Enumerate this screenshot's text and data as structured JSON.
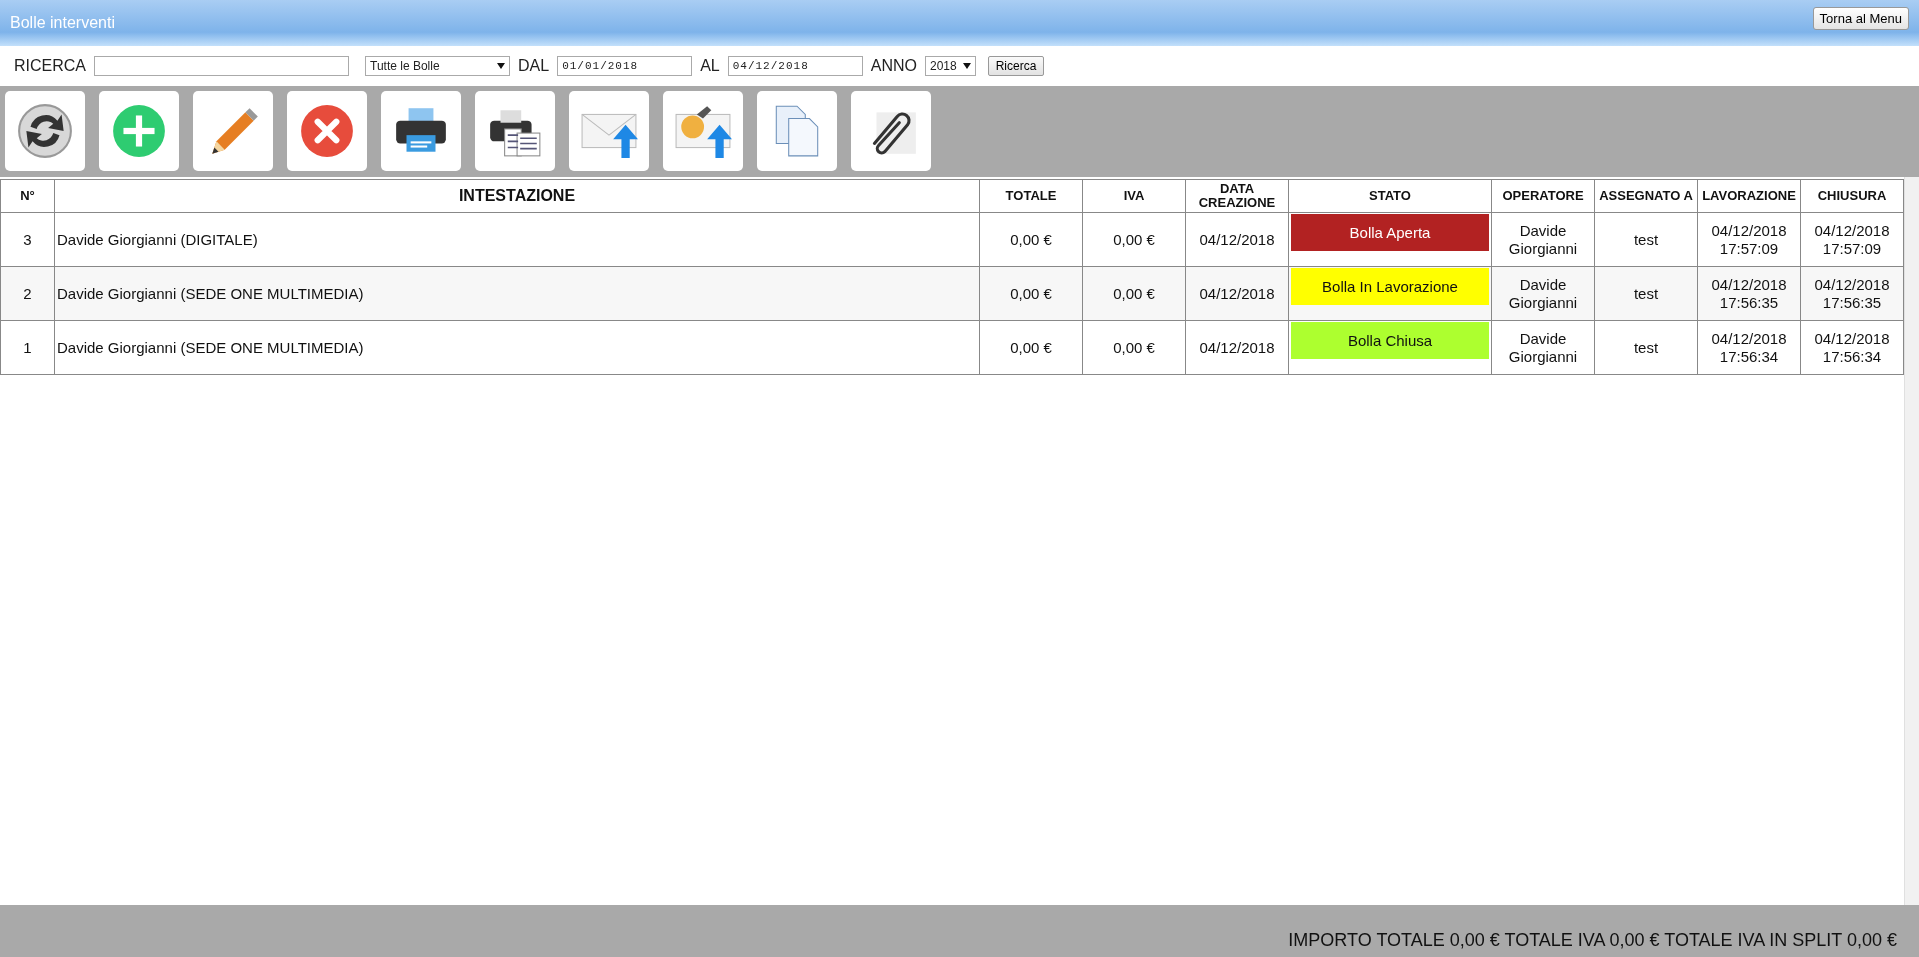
{
  "window": {
    "title": "Bolle interventi",
    "menu_button": "Torna al Menu"
  },
  "search_bar": {
    "search_label": "RICERCA",
    "filter": "Tutte le Bolle",
    "from_label": "DAL",
    "from_value": "01/01/2018",
    "to_label": "AL",
    "to_value": "04/12/2018",
    "year_label": "ANNO",
    "year": "2018",
    "button": "Ricerca"
  },
  "toolbar": [
    {
      "kind": "refresh"
    },
    {
      "kind": "add"
    },
    {
      "kind": "edit"
    },
    {
      "kind": "delete"
    },
    {
      "kind": "print"
    },
    {
      "kind": "print-list"
    },
    {
      "kind": "send-mail"
    },
    {
      "kind": "send-mail-service"
    },
    {
      "kind": "copy"
    },
    {
      "kind": "attach"
    }
  ],
  "table": {
    "columns": [
      "N°",
      "INTESTAZIONE",
      "TOTALE",
      "IVA",
      "DATA CREAZIONE",
      "STATO",
      "OPERATORE",
      "ASSEGNATO A",
      "LAVORAZIONE",
      "CHIUSURA"
    ],
    "rows": [
      {
        "number": "3",
        "intestazione": "Davide Giorgianni (DIGITALE)",
        "totale": "0,00 €",
        "iva": "0,00 €",
        "data": "04/12/2018",
        "stato": "Bolla Aperta",
        "color": "#b22222",
        "operatore": "Davide Giorgianni",
        "assegnato": "test",
        "lavorazione": "04/12/2018 17:57:09",
        "chiusura": "04/12/2018 17:57:09"
      },
      {
        "number": "2",
        "intestazione": "Davide Giorgianni (SEDE ONE MULTIMEDIA)",
        "totale": "0,00 €",
        "iva": "0,00 €",
        "data": "04/12/2018",
        "stato": "Bolla In Lavorazione",
        "color": "#ffff00",
        "operatore": "Davide Giorgianni",
        "assegnato": "test",
        "lavorazione": "04/12/2018 17:56:35",
        "chiusura": "04/12/2018 17:56:35"
      },
      {
        "number": "1",
        "intestazione": "Davide Giorgianni (SEDE ONE MULTIMEDIA)",
        "totale": "0,00 €",
        "iva": "0,00 €",
        "data": "04/12/2018",
        "stato": "Bolla Chiusa",
        "color": "#adff2f",
        "operatore": "Davide Giorgianni",
        "assegnato": "test",
        "lavorazione": "04/12/2018 17:56:34",
        "chiusura": "04/12/2018 17:56:34"
      }
    ]
  },
  "status_bar": "IMPORTO TOTALE 0,00 € TOTALE IVA 0,00 € TOTALE IVA IN SPLIT 0,00 €"
}
